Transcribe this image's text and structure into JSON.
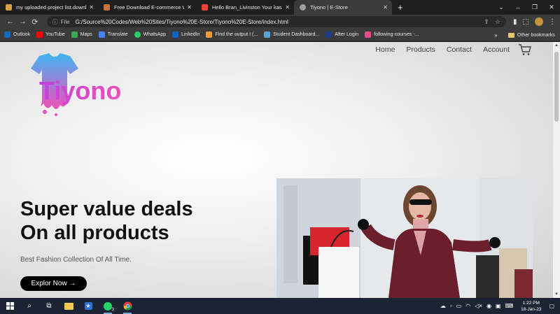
{
  "browser": {
    "tabs": [
      {
        "title": "my uploaded project list.downlo",
        "color": "#d9a04a",
        "active": false
      },
      {
        "title": "Free Download E-commerce Wel",
        "color": "#c9733a",
        "active": false
      },
      {
        "title": "Hello Bran_Livinston Your kaship",
        "color": "#ea4335",
        "active": false
      },
      {
        "title": "Tiyono | E-Store",
        "color": "#9aa0a6",
        "active": true
      }
    ],
    "close_glyph": "✕",
    "new_tab_glyph": "+",
    "window_controls": [
      "⌄",
      "–",
      "❐",
      "✕"
    ],
    "nav": {
      "back": "←",
      "forward": "→",
      "reload": "⟳"
    },
    "omnibox": {
      "scheme_label": "File",
      "url": "G:/Source%20Codes/Web%20Sites/Tiyono%20E-Store/Tiyono%20E-Store/index.html"
    },
    "bookmarks": [
      {
        "label": "Outlook",
        "color": "#0f6cbd"
      },
      {
        "label": "YouTube",
        "color": "#ff0000"
      },
      {
        "label": "Maps",
        "color": "#34a853"
      },
      {
        "label": "Translate",
        "color": "#4285f4"
      },
      {
        "label": "WhatsApp",
        "color": "#25d366"
      },
      {
        "label": "LinkedIn",
        "color": "#0a66c2"
      },
      {
        "label": "Find the output I (...",
        "color": "#f29b38"
      },
      {
        "label": "Student Dashboard...",
        "color": "#5aa3d8"
      },
      {
        "label": "After Login",
        "color": "#1f3c88"
      },
      {
        "label": "following-courses -...",
        "color": "#e94c89"
      }
    ],
    "bookmarks_more": "»",
    "other_bookmarks": "Other bookmarks"
  },
  "site": {
    "brand": "Tiyono",
    "nav": [
      "Home",
      "Products",
      "Contact",
      "Account"
    ],
    "hero": {
      "title_line1": "Super value deals",
      "title_line2": "On all products",
      "subtitle": "Best Fashion Collection Of All Time.",
      "cta": "Explor Now →"
    }
  },
  "taskbar": {
    "time": "1:22 PM",
    "date": "18-Jan-23",
    "whatsapp_badge": "3"
  },
  "colors": {
    "logo_gradient_start": "#3fb6f2",
    "logo_gradient_end": "#f04fb8",
    "cta_bg": "#000000",
    "taskbar_bg": "#1c2433"
  }
}
